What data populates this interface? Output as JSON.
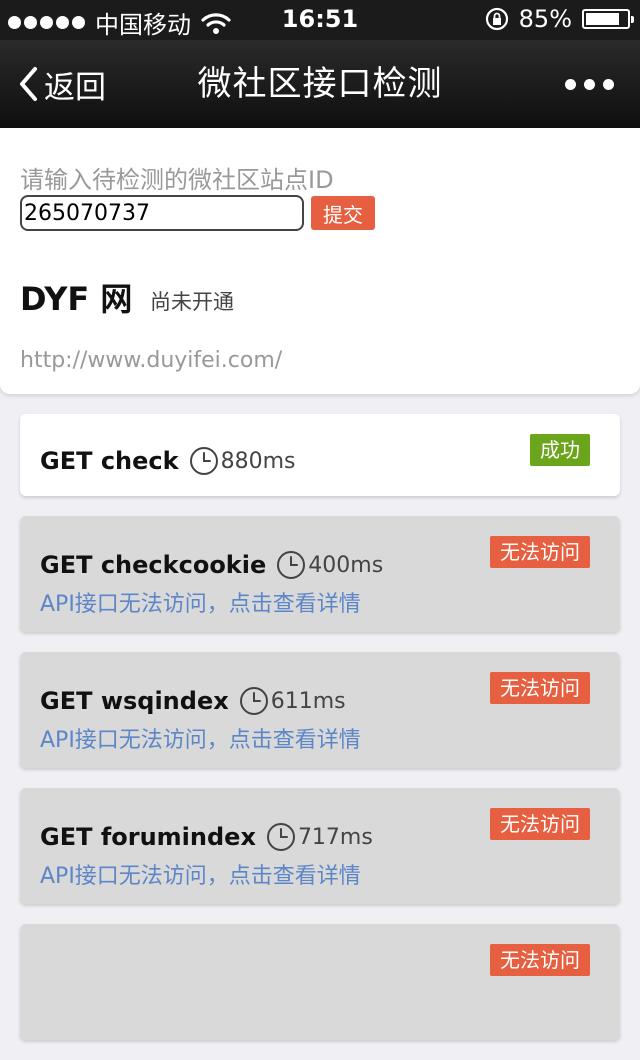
{
  "status_bar": {
    "carrier": "中国移动",
    "time": "16:51",
    "battery": "85%",
    "battery_level": 0.85
  },
  "nav": {
    "back_label": "返回",
    "title": "微社区接口检测"
  },
  "site": {
    "prompt": "请输入待检测的微社区站点ID",
    "id_value": "265070737",
    "submit_label": "提交",
    "name": "DYF 网",
    "status": "尚未开通",
    "url": "http://www.duyifei.com/"
  },
  "colors": {
    "success": "#6aa51c",
    "failure": "#e65f40",
    "link": "#5d86c8"
  },
  "apis": [
    {
      "name": "GET check",
      "time": "880ms",
      "badge": "成功",
      "state": "success",
      "detail": ""
    },
    {
      "name": "GET checkcookie",
      "time": "400ms",
      "badge": "无法访问",
      "state": "failure",
      "detail": "API接口无法访问，点击查看详情"
    },
    {
      "name": "GET wsqindex",
      "time": "611ms",
      "badge": "无法访问",
      "state": "failure",
      "detail": "API接口无法访问，点击查看详情"
    },
    {
      "name": "GET forumindex",
      "time": "717ms",
      "badge": "无法访问",
      "state": "failure",
      "detail": "API接口无法访问，点击查看详情"
    },
    {
      "name": "",
      "time": "",
      "badge": "无法访问",
      "state": "failure",
      "detail": ""
    }
  ]
}
